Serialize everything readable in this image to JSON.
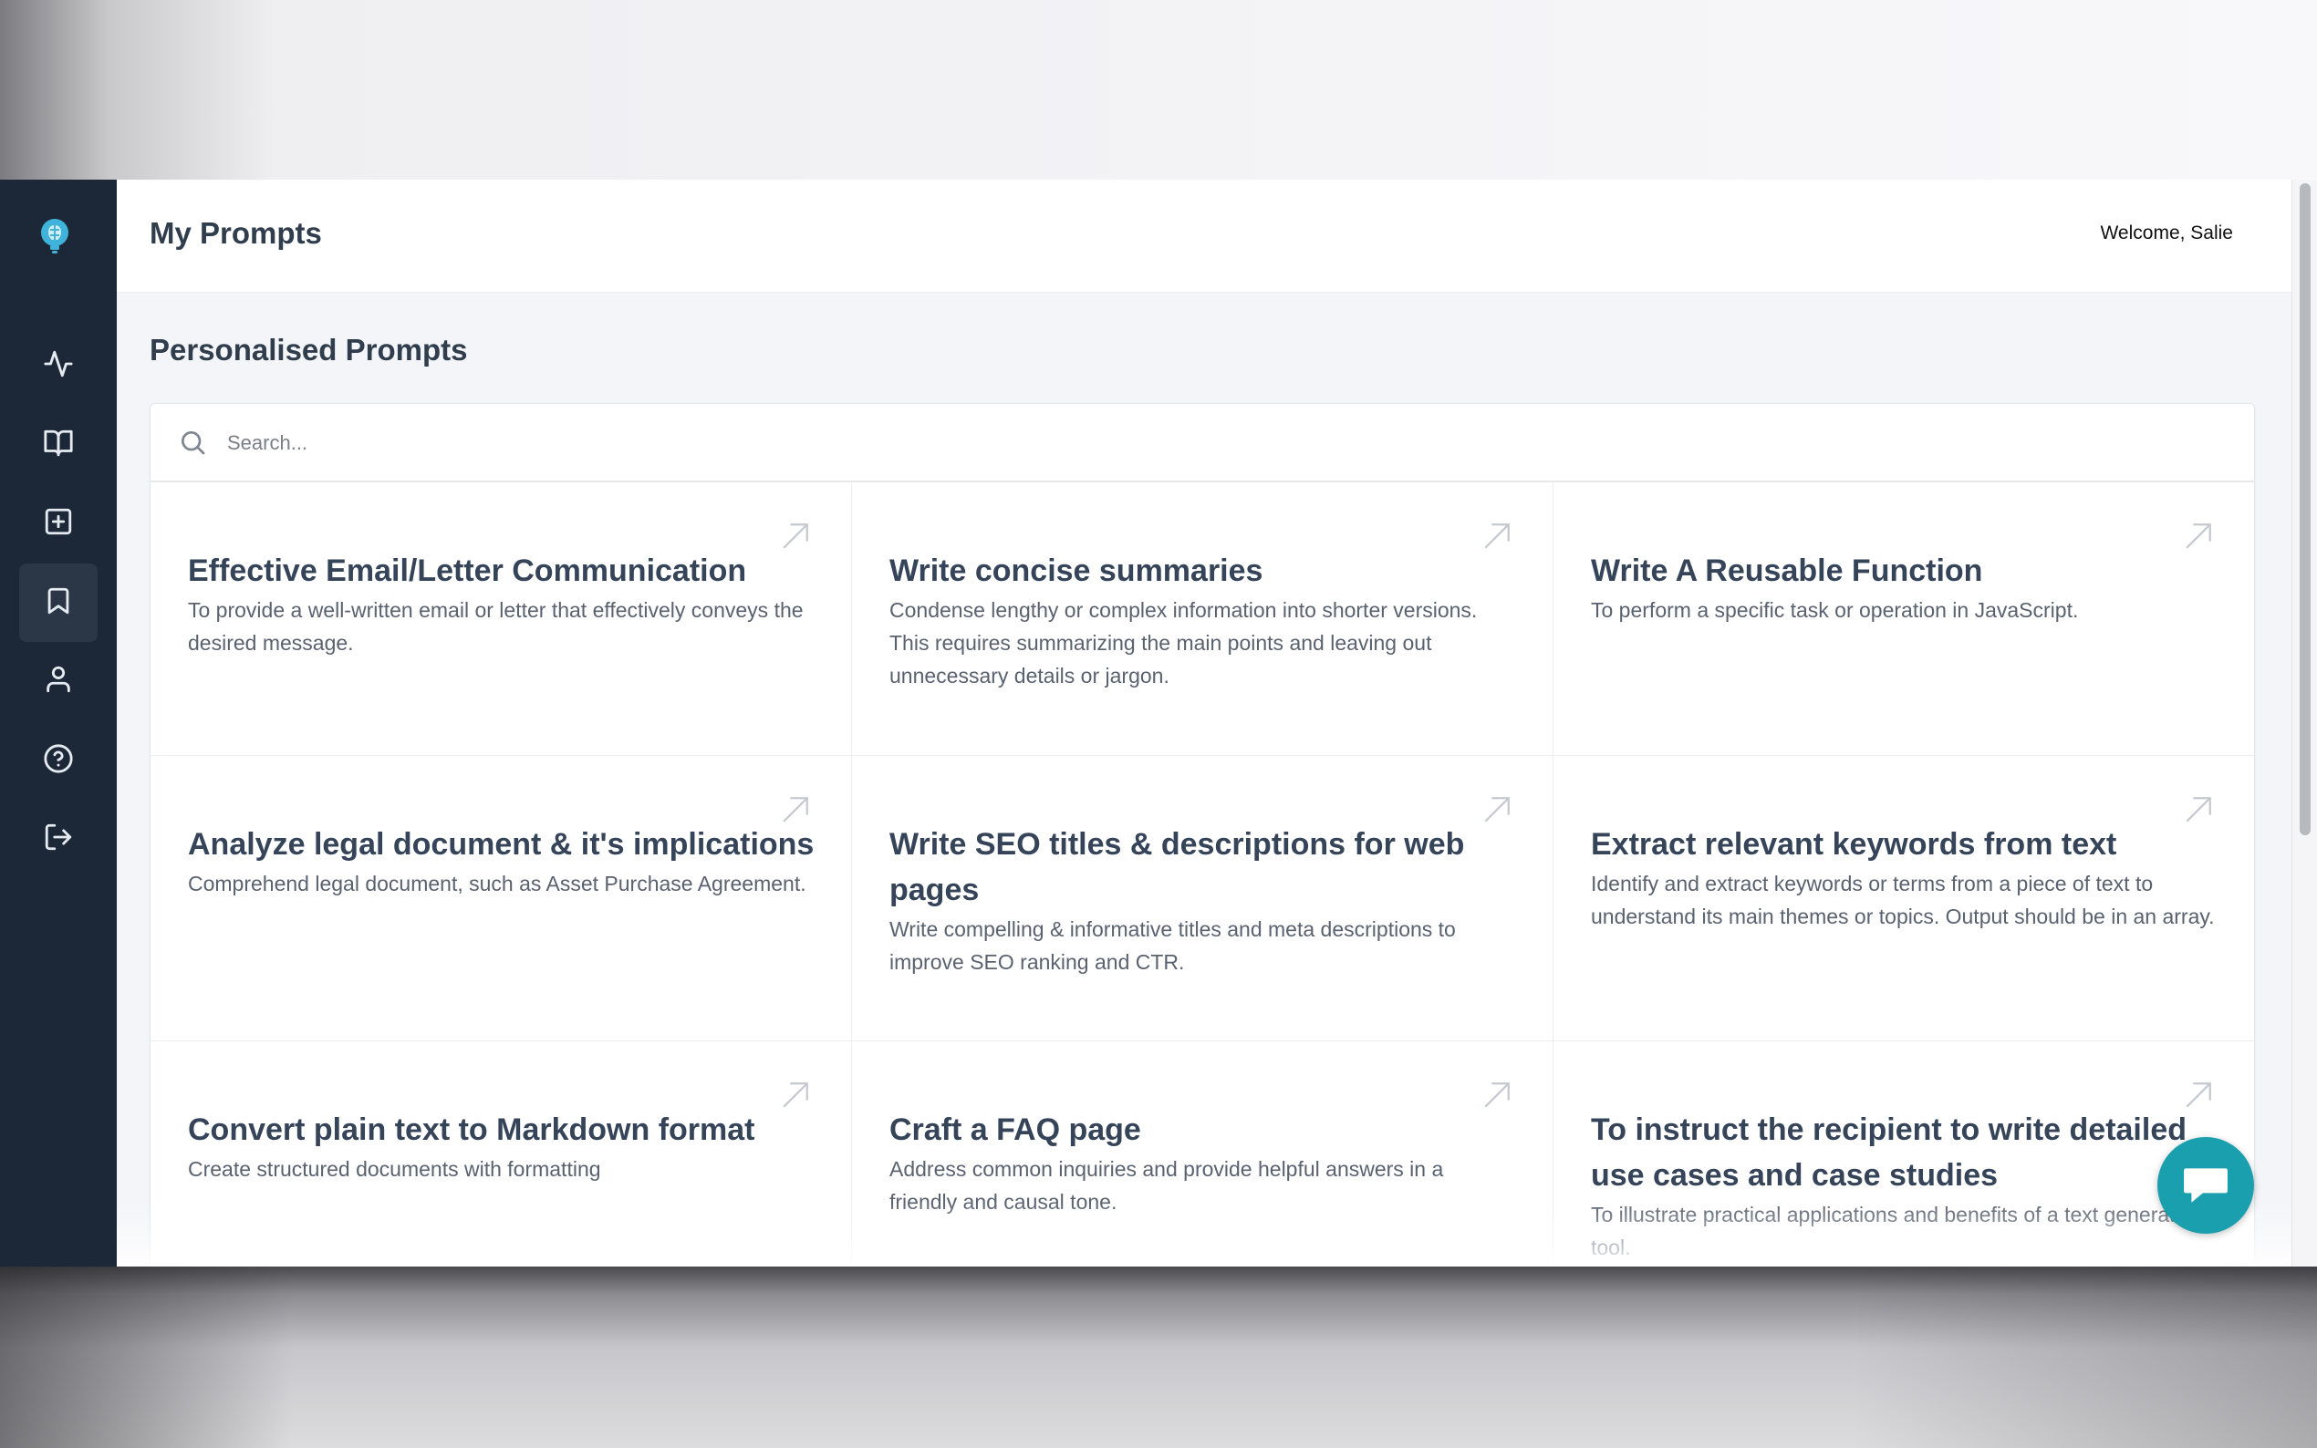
{
  "header": {
    "title": "My Prompts",
    "welcome": "Welcome, Salie"
  },
  "sidebar": {
    "items": [
      {
        "icon": "activity-icon"
      },
      {
        "icon": "book-open-icon"
      },
      {
        "icon": "plus-square-icon"
      },
      {
        "icon": "bookmark-icon",
        "active": true
      },
      {
        "icon": "user-icon"
      },
      {
        "icon": "help-circle-icon"
      },
      {
        "icon": "logout-icon"
      }
    ]
  },
  "section": {
    "title": "Personalised Prompts"
  },
  "search": {
    "placeholder": "Search..."
  },
  "cards": [
    {
      "title": "Effective Email/Letter Communication",
      "desc": "To provide a well-written email or letter that effectively conveys the desired message."
    },
    {
      "title": "Write concise summaries",
      "desc": "Condense lengthy or complex information into shorter versions. This requires summarizing the main points and leaving out unnecessary details or jargon."
    },
    {
      "title": "Write A Reusable Function",
      "desc": "To perform a specific task or operation in JavaScript."
    },
    {
      "title": "Analyze legal document & it's implications",
      "desc": "Comprehend legal document, such as Asset Purchase Agreement."
    },
    {
      "title": "Write SEO titles & descriptions for web pages",
      "desc": "Write compelling & informative titles and meta descriptions to improve SEO ranking and CTR."
    },
    {
      "title": "Extract relevant keywords from text",
      "desc": "Identify and extract keywords or terms from a piece of text to understand its main themes or topics. Output should be in an array."
    },
    {
      "title": "Convert plain text to Markdown format",
      "desc": "Create structured documents with formatting"
    },
    {
      "title": "Craft a FAQ page",
      "desc": "Address common inquiries and provide helpful answers in a friendly and causal tone."
    },
    {
      "title": "To instruct the recipient to write detailed use cases and case studies",
      "desc": "To illustrate practical applications and benefits of a text generation tool."
    }
  ],
  "colors": {
    "sidebar": "#1c2838",
    "accent": "#1a9fae",
    "title_text": "#354458"
  }
}
